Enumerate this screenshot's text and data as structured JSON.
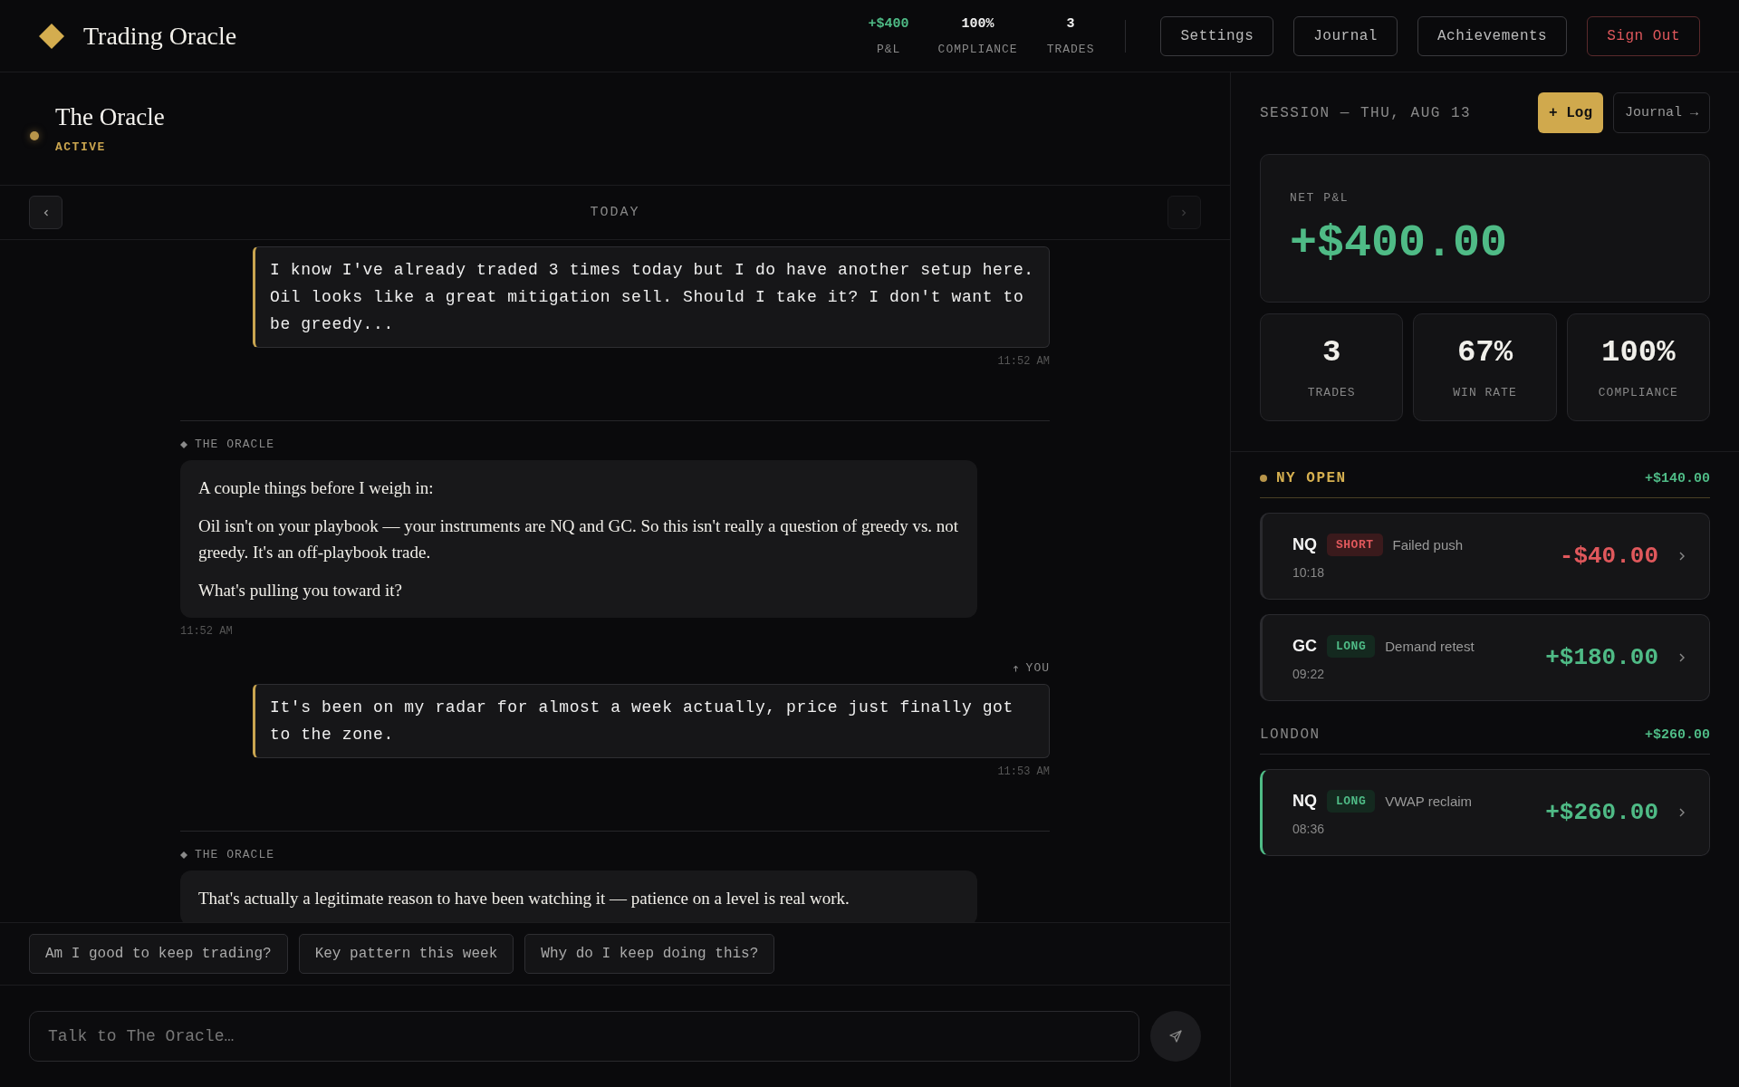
{
  "app": {
    "title": "Trading Oracle"
  },
  "header_stats": [
    {
      "value": "+$400",
      "label": "P&L",
      "positive": true
    },
    {
      "value": "100%",
      "label": "COMPLIANCE",
      "positive": false
    },
    {
      "value": "3",
      "label": "TRADES",
      "positive": false
    }
  ],
  "header_buttons": [
    {
      "label": "Settings",
      "kind": "normal"
    },
    {
      "label": "Journal",
      "kind": "normal"
    },
    {
      "label": "Achievements",
      "kind": "normal"
    },
    {
      "label": "Sign Out",
      "kind": "danger"
    }
  ],
  "agent": {
    "name": "The Oracle",
    "status": "ACTIVE"
  },
  "day_nav": {
    "label": "TODAY",
    "prev_disabled": false,
    "next_disabled": true
  },
  "messages": [
    {
      "kind": "user",
      "paragraphs": [
        "I know I've already traded 3 times today but I do have another setup here. Oil looks like a great mitigation sell. Should I take it? I don't want to be greedy..."
      ],
      "time": "11:52 AM"
    },
    {
      "kind": "oracle",
      "label": "THE ORACLE",
      "paragraphs": [
        "A couple things before I weigh in:",
        "Oil isn't on your playbook — your instruments are NQ and GC. So this isn't really a question of greedy vs. not greedy. It's an off-playbook trade.",
        "What's pulling you toward it?"
      ],
      "time": "11:52 AM"
    },
    {
      "kind": "user",
      "label": "YOU",
      "paragraphs": [
        "It's been on my radar for almost a week actually, price just finally got to the zone."
      ],
      "time": "11:53 AM"
    },
    {
      "kind": "oracle",
      "label": "THE ORACLE",
      "paragraphs": [
        "That's actually a legitimate reason to have been watching it — patience on a level is real work."
      ]
    }
  ],
  "suggestions": [
    "Am I good to keep trading?",
    "Key pattern this week",
    "Why do I keep doing this?"
  ],
  "composer": {
    "placeholder": "Talk to The Oracle…"
  },
  "session": {
    "title": "SESSION — THU, AUG 13",
    "log_button": "+ Log",
    "journal_button": "Journal →",
    "net_pnl": {
      "label": "NET P&L",
      "value": "+$400.00"
    },
    "stats": [
      {
        "value": "3",
        "label": "TRADES"
      },
      {
        "value": "67%",
        "label": "WIN RATE"
      },
      {
        "value": "100%",
        "label": "COMPLIANCE"
      }
    ],
    "groups": [
      {
        "name": "NY OPEN",
        "active": true,
        "total": "+$140.00",
        "trades": [
          {
            "symbol": "NQ",
            "side": "SHORT",
            "kind": "short",
            "note": "Failed push",
            "time": "10:18",
            "pnl": "-$40.00",
            "loss": true,
            "selected": false
          },
          {
            "symbol": "GC",
            "side": "LONG",
            "kind": "long",
            "note": "Demand retest",
            "time": "09:22",
            "pnl": "+$180.00",
            "loss": false,
            "selected": false
          }
        ]
      },
      {
        "name": "LONDON",
        "active": false,
        "total": "+$260.00",
        "trades": [
          {
            "symbol": "NQ",
            "side": "LONG",
            "kind": "long",
            "note": "VWAP reclaim",
            "time": "08:36",
            "pnl": "+$260.00",
            "loss": false,
            "selected": true
          }
        ]
      }
    ]
  }
}
